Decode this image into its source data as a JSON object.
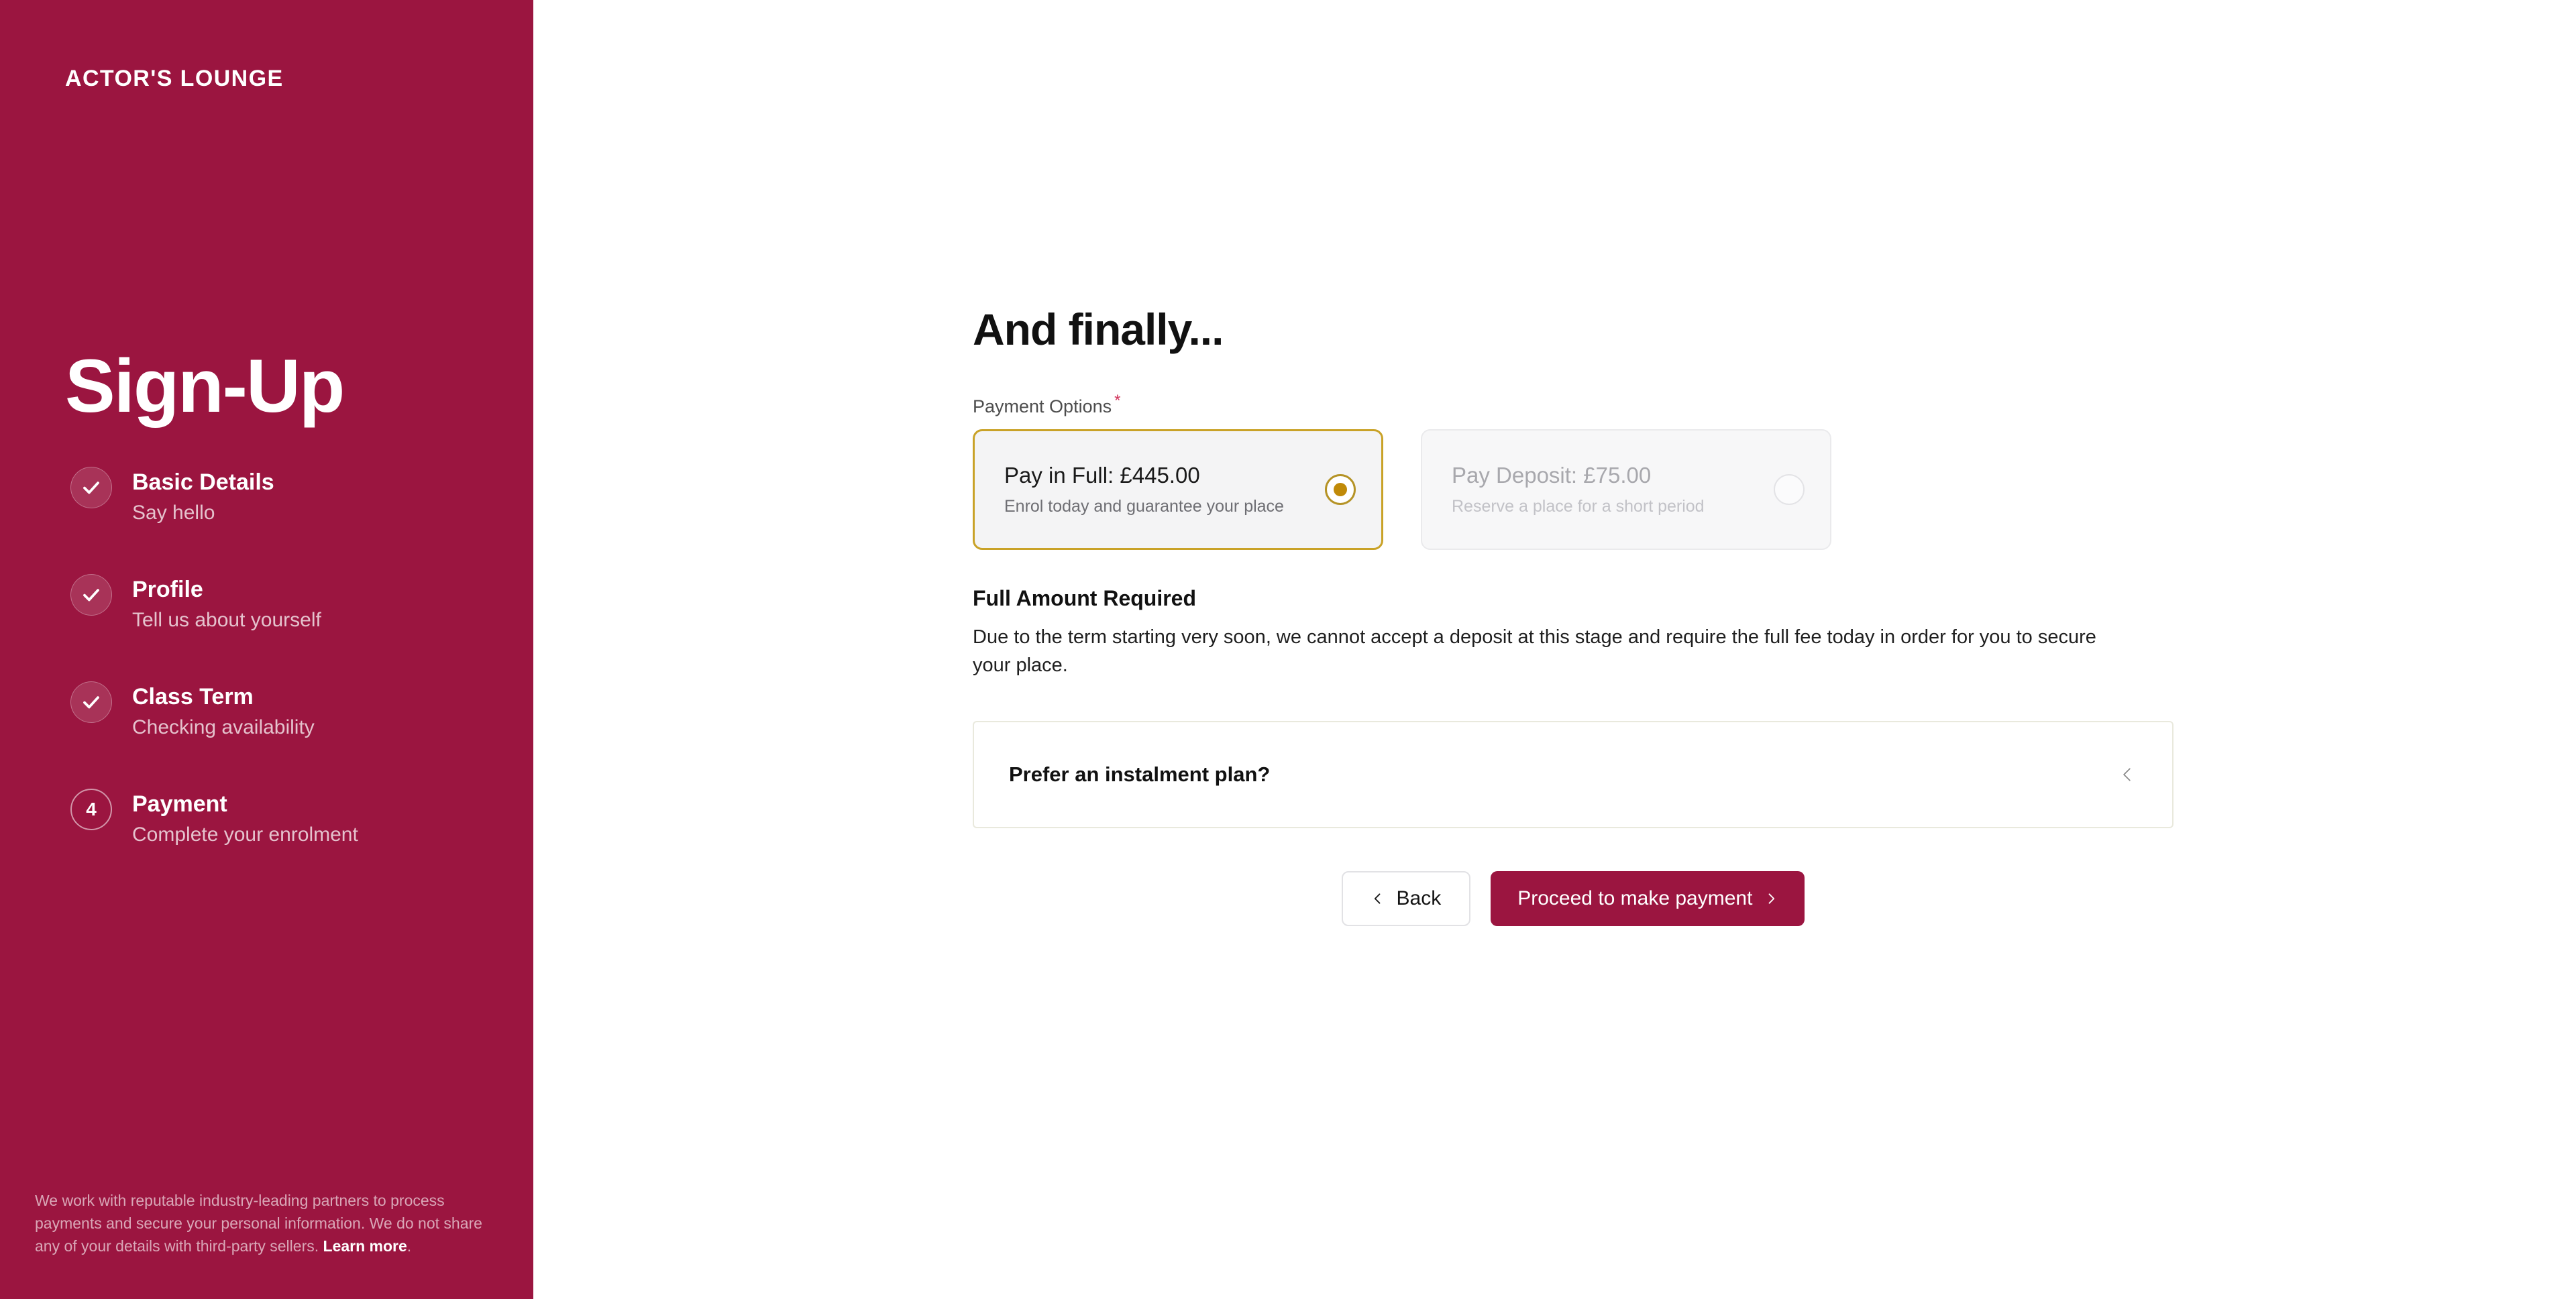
{
  "sidebar": {
    "brand": "ACTOR'S LOUNGE",
    "title": "Sign-Up",
    "accent_color": "#9b1540",
    "steps": [
      {
        "number": "1",
        "label": "Basic Details",
        "sub": "Say hello",
        "state": "done",
        "icon": "check-icon"
      },
      {
        "number": "2",
        "label": "Profile",
        "sub": "Tell us about yourself",
        "state": "done",
        "icon": "check-icon"
      },
      {
        "number": "3",
        "label": "Class Term",
        "sub": "Checking availability",
        "state": "done",
        "icon": "check-icon"
      },
      {
        "number": "4",
        "label": "Payment",
        "sub": "Complete your enrolment",
        "state": "current",
        "icon": "step-number"
      }
    ],
    "footer": {
      "text": "We work with reputable industry-leading partners to process payments and secure your personal information. We do not share any of your details with third-party sellers. ",
      "link": "Learn more",
      "suffix": "."
    }
  },
  "main": {
    "heading": "And finally...",
    "payment_options_label": "Payment Options",
    "required_marker": "*",
    "options": [
      {
        "title": "Pay in Full: £445.00",
        "sub": "Enrol today and guarantee your place",
        "state": "selected",
        "radio_icon": "radio-selected-icon",
        "accent": "#c9a227"
      },
      {
        "title": "Pay Deposit: £75.00",
        "sub": "Reserve a place for a short period",
        "state": "disabled",
        "radio_icon": "radio-unselected-icon",
        "accent": "#e3e3e6"
      }
    ],
    "notice": {
      "title": "Full Amount Required",
      "body": "Due to the term starting very soon, we cannot accept a deposit at this stage and require the full fee today in order for you to secure your place."
    },
    "accordion": {
      "title": "Prefer an instalment plan?",
      "chevron_icon": "chevron-left-icon",
      "expanded": "false"
    },
    "buttons": {
      "back": "Back",
      "back_icon": "chevron-left-icon",
      "proceed": "Proceed to make payment",
      "proceed_icon": "chevron-right-icon"
    }
  }
}
